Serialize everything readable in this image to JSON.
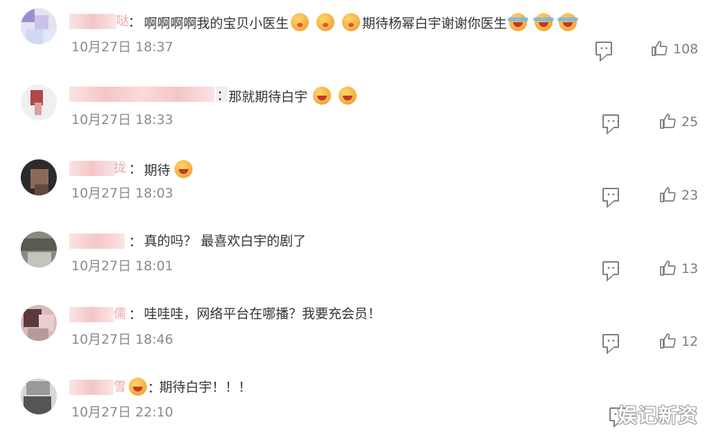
{
  "comments": [
    {
      "name_tail": "哒",
      "segments": [
        "：",
        "啊啊啊啊我的宝贝小医生",
        "期待杨幂白宇谢谢你医生"
      ],
      "time": "10月27日 18:37",
      "likes": "108",
      "emojis_inline": [
        "kiss-emoji",
        "kiss-emoji",
        "kiss-emoji",
        "laugh-cry-emoji",
        "laugh-cry-emoji",
        "laugh-cry-emoji"
      ]
    },
    {
      "name_tail": "",
      "segments": [
        "：",
        "那就期待白宇"
      ],
      "time": "10月27日 18:33",
      "likes": "25",
      "emojis_inline": [
        "crying-emoji",
        "crying-emoji"
      ]
    },
    {
      "name_tail": "拢",
      "segments": [
        "：",
        "期待"
      ],
      "time": "10月27日 18:03",
      "likes": "23",
      "emojis_inline": [
        "crying-emoji"
      ]
    },
    {
      "name_tail": "",
      "segments": [
        "：",
        "真的吗？ 最喜欢白宇的剧了"
      ],
      "time": "10月27日 18:01",
      "likes": "13",
      "emojis_inline": []
    },
    {
      "name_tail": "儒",
      "segments": [
        "：",
        "哇哇哇，网络平台在哪播？我要充会员！"
      ],
      "time": "10月27日 18:46",
      "likes": "12",
      "emojis_inline": []
    },
    {
      "name_tail": "雪",
      "segments": [
        "：",
        "期待白宇！！！"
      ],
      "time": "10月27日 22:10",
      "likes": "",
      "emojis_inline": [
        "heart-eyes-emoji"
      ]
    }
  ],
  "watermark": "娱记新资",
  "colors": {
    "text": "#333333",
    "time": "#8a8a8a",
    "icon": "#7d7d7d",
    "username_blur": "#f4c6c6"
  }
}
